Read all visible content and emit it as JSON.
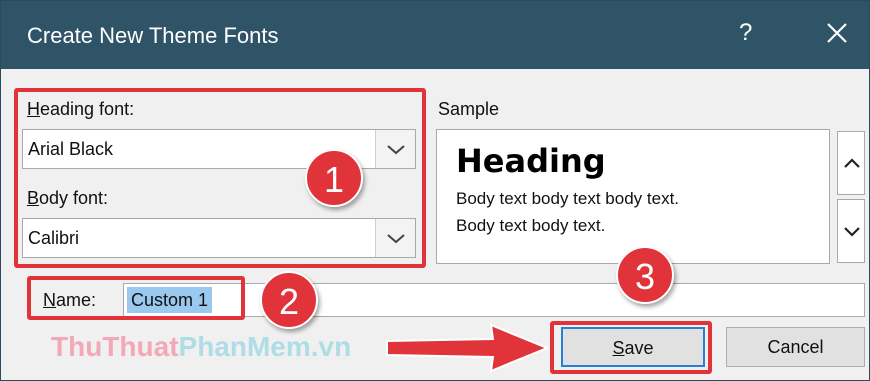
{
  "window": {
    "title": "Create New Theme Fonts",
    "help_glyph": "?"
  },
  "heading_font": {
    "label_access": "H",
    "label_rest": "eading font:",
    "value": "Arial Black"
  },
  "body_font": {
    "label_access": "B",
    "label_rest": "ody font:",
    "value": "Calibri"
  },
  "sample": {
    "label": "Sample",
    "heading": "Heading",
    "body_line1": "Body text body text body text.",
    "body_line2": "Body text body text."
  },
  "name": {
    "label_access": "N",
    "label_rest": "ame:",
    "value": "Custom 1"
  },
  "buttons": {
    "save_access": "S",
    "save_rest": "ave",
    "cancel": "Cancel"
  },
  "annotations": {
    "badge1": "1",
    "badge2": "2",
    "badge3": "3",
    "highlight_color": "#e0343a"
  },
  "watermark": {
    "part1": "ThuThuat",
    "part2": "PhanMem",
    "part3": ".vn"
  },
  "icons": [
    "close-icon",
    "chevron-down-icon",
    "chevron-up-icon",
    "arrow-right-icon"
  ]
}
